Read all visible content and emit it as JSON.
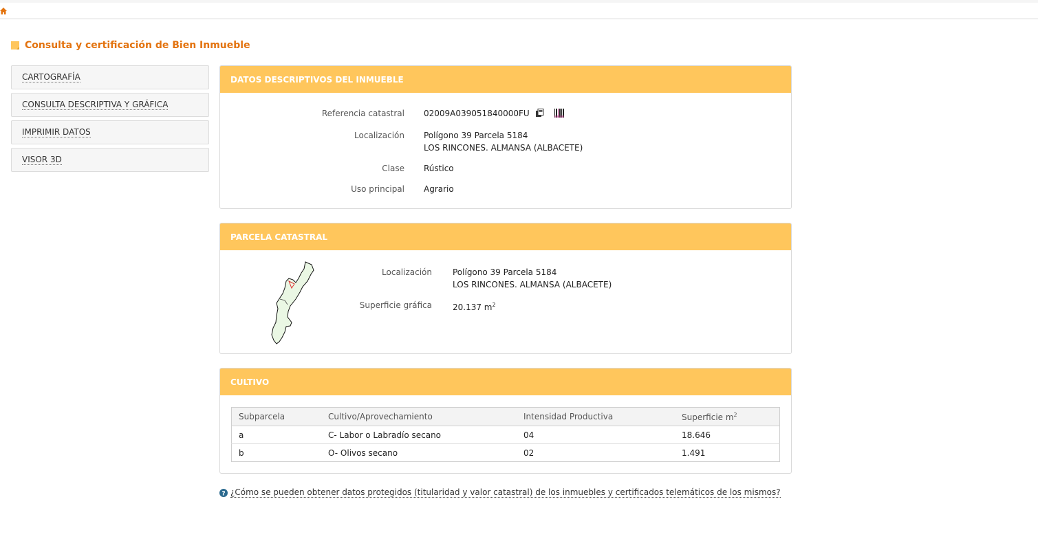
{
  "page": {
    "title": "Consulta y certificación de Bien Inmueble"
  },
  "sidebar": {
    "items": [
      {
        "label": "CARTOGRAFÍA"
      },
      {
        "label": "CONSULTA DESCRIPTIVA Y GRÁFICA"
      },
      {
        "label": "IMPRIMIR DATOS"
      },
      {
        "label": "VISOR 3D"
      }
    ]
  },
  "datos": {
    "title": "DATOS DESCRIPTIVOS DEL INMUEBLE",
    "ref_label": "Referencia catastral",
    "ref_value": "02009A039051840000FU",
    "loc_label": "Localización",
    "loc_line1": "Polígono 39 Parcela 5184",
    "loc_line2": "LOS RINCONES. ALMANSA (ALBACETE)",
    "clase_label": "Clase",
    "clase_value": "Rústico",
    "uso_label": "Uso principal",
    "uso_value": "Agrario"
  },
  "parcela": {
    "title": "PARCELA CATASTRAL",
    "loc_label": "Localización",
    "loc_line1": "Polígono 39 Parcela 5184",
    "loc_line2": "LOS RINCONES. ALMANSA (ALBACETE)",
    "sup_label": "Superficie gráfica",
    "sup_value": "20.137 m",
    "sup_exp": "2"
  },
  "cultivo": {
    "title": "CULTIVO",
    "headers": [
      "Subparcela",
      "Cultivo/Aprovechamiento",
      "Intensidad Productiva",
      "Superficie m"
    ],
    "header_exp": "2",
    "rows": [
      [
        "a",
        "C- Labor o Labradío secano",
        "04",
        "18.646"
      ],
      [
        "b",
        "O- Olivos secano",
        "02",
        "1.491"
      ]
    ]
  },
  "help": {
    "link": "¿Cómo se pueden obtener datos protegidos (titularidad y valor catastral) de los inmuebles y certificados telemáticos de los mismos?"
  },
  "colors": {
    "accent": "#e3730f",
    "panel_header": "#ffc65c"
  }
}
